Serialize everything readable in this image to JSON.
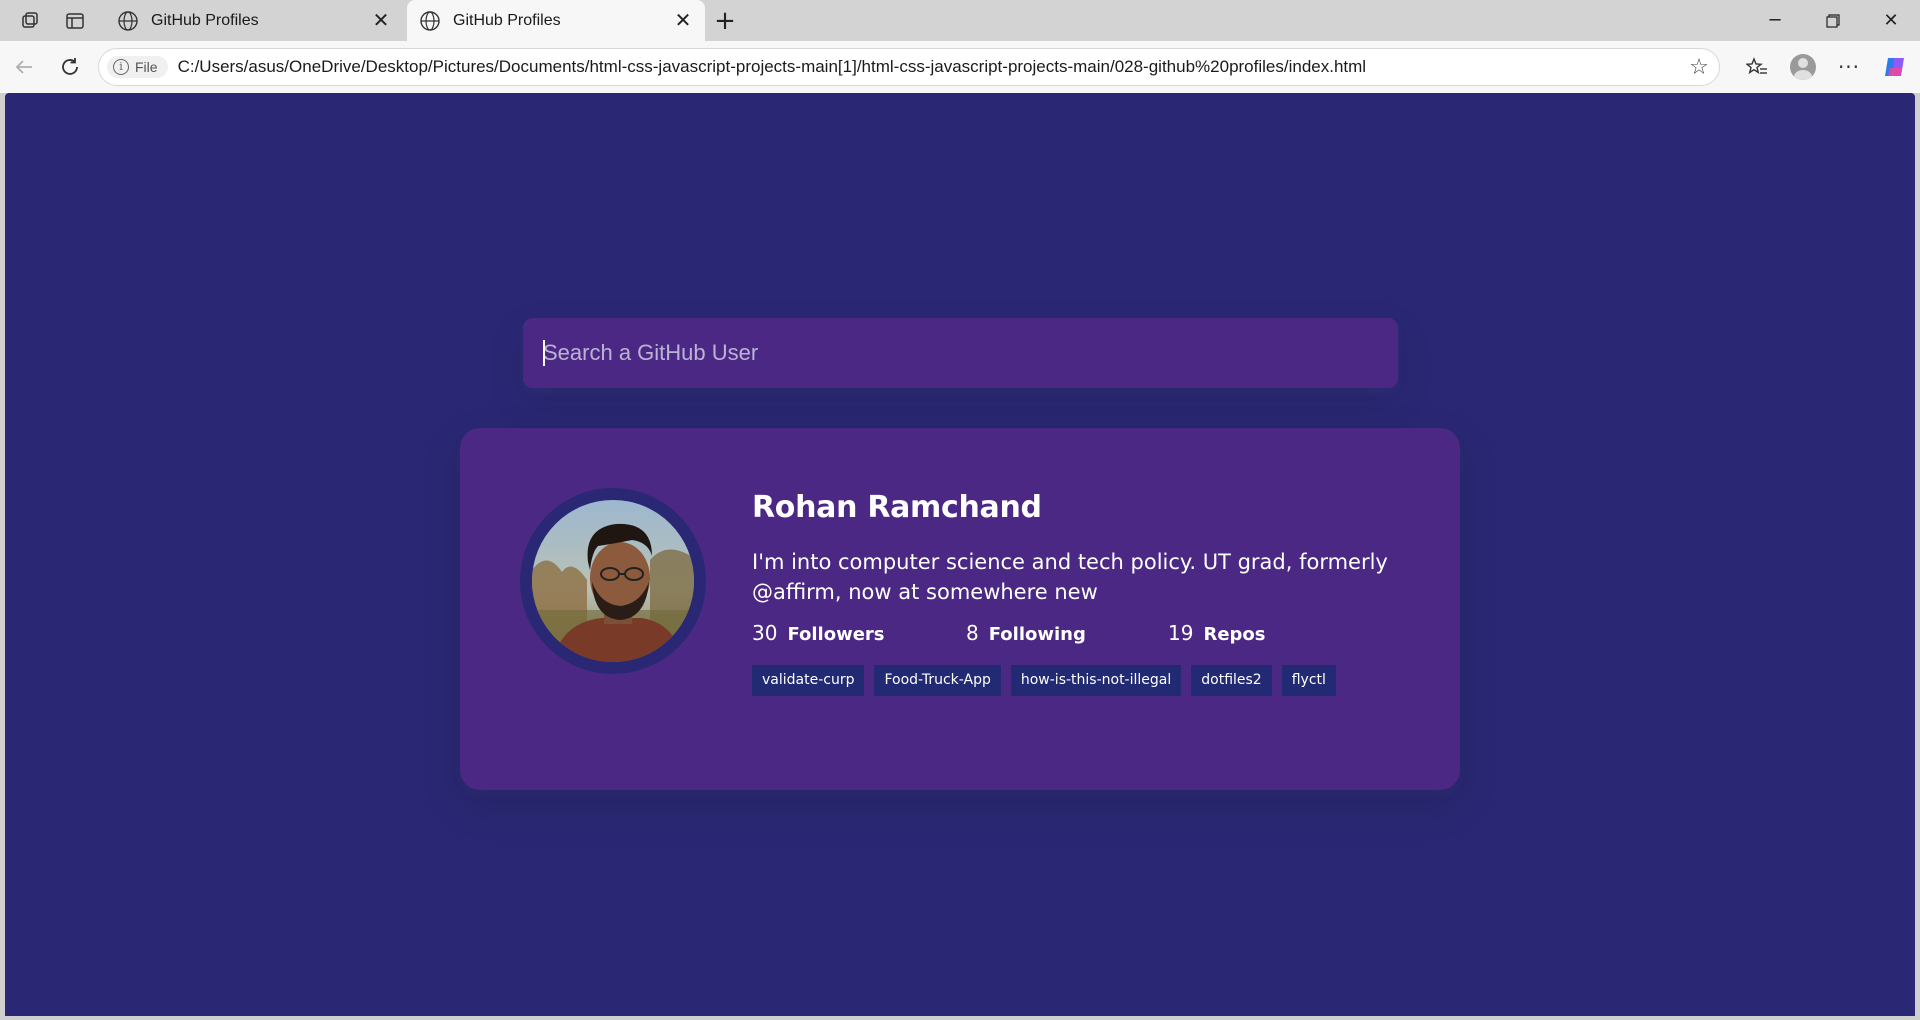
{
  "browser": {
    "tabs": [
      {
        "title": "GitHub Profiles",
        "active": false
      },
      {
        "title": "GitHub Profiles",
        "active": true
      }
    ],
    "new_tab_symbol": "+",
    "address": {
      "scheme_label": "File",
      "url": "C:/Users/asus/OneDrive/Desktop/Pictures/Documents/html-css-javascript-projects-main[1]/html-css-javascript-projects-main/028-github%20profiles/index.html"
    }
  },
  "colors": {
    "page_bg": "#2a2874",
    "card_bg": "#4c2885",
    "repo_bg": "#212a72",
    "text": "#ffffff"
  },
  "search": {
    "placeholder": "Search a GitHub User",
    "value": ""
  },
  "profile": {
    "name": "Rohan Ramchand",
    "bio": "I'm into computer science and tech policy. UT grad, formerly @affirm, now at somewhere new",
    "followers": {
      "count": "30",
      "label": "Followers"
    },
    "following": {
      "count": "8",
      "label": "Following"
    },
    "repos": {
      "count": "19",
      "label": "Repos"
    },
    "repo_links": [
      "validate-curp",
      "Food-Truck-App",
      "how-is-this-not-illegal",
      "dotfiles2",
      "flyctl"
    ]
  },
  "icons": {
    "workspaces": "workspaces-icon",
    "tab_actions": "tab-actions-icon",
    "globe": "globe-icon",
    "close": "close-icon",
    "minimize": "minimize-icon",
    "restore": "restore-icon",
    "back": "back-arrow-icon",
    "reload": "reload-icon",
    "info": "info-icon",
    "favorite": "star-icon",
    "favorites": "favorites-list-icon",
    "profile": "profile-icon",
    "more": "more-dots-icon",
    "copilot": "copilot-icon"
  }
}
